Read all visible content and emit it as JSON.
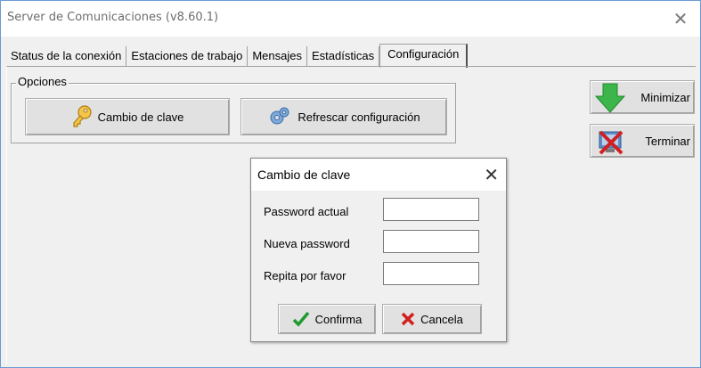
{
  "window": {
    "title": "Server de Comunicaciones (v8.60.1)",
    "close_glyph": "✕"
  },
  "tabs": [
    {
      "label": "Status de la conexión"
    },
    {
      "label": "Estaciones de trabajo"
    },
    {
      "label": "Mensajes"
    },
    {
      "label": "Estadísticas"
    },
    {
      "label": "Configuración",
      "active": true
    }
  ],
  "options": {
    "group_label": "Opciones",
    "change_password_label": "Cambio de clave",
    "refresh_config_label": "Refrescar configuración"
  },
  "side_buttons": {
    "minimize_label": "Minimizar",
    "terminate_label": "Terminar"
  },
  "dialog": {
    "title": "Cambio de clave",
    "close_glyph": "✕",
    "fields": [
      {
        "label": "Password actual",
        "value": ""
      },
      {
        "label": "Nueva password",
        "value": ""
      },
      {
        "label": "Repita por favor",
        "value": ""
      }
    ],
    "confirm_label": "Confirma",
    "cancel_label": "Cancela"
  },
  "colors": {
    "accent_green": "#3cb54a",
    "cancel_red": "#d21f1f",
    "window_border": "#6b9bd1"
  },
  "icons": [
    "key-icon",
    "gears-icon",
    "down-arrow-icon",
    "terminate-icon",
    "check-icon",
    "x-icon"
  ]
}
